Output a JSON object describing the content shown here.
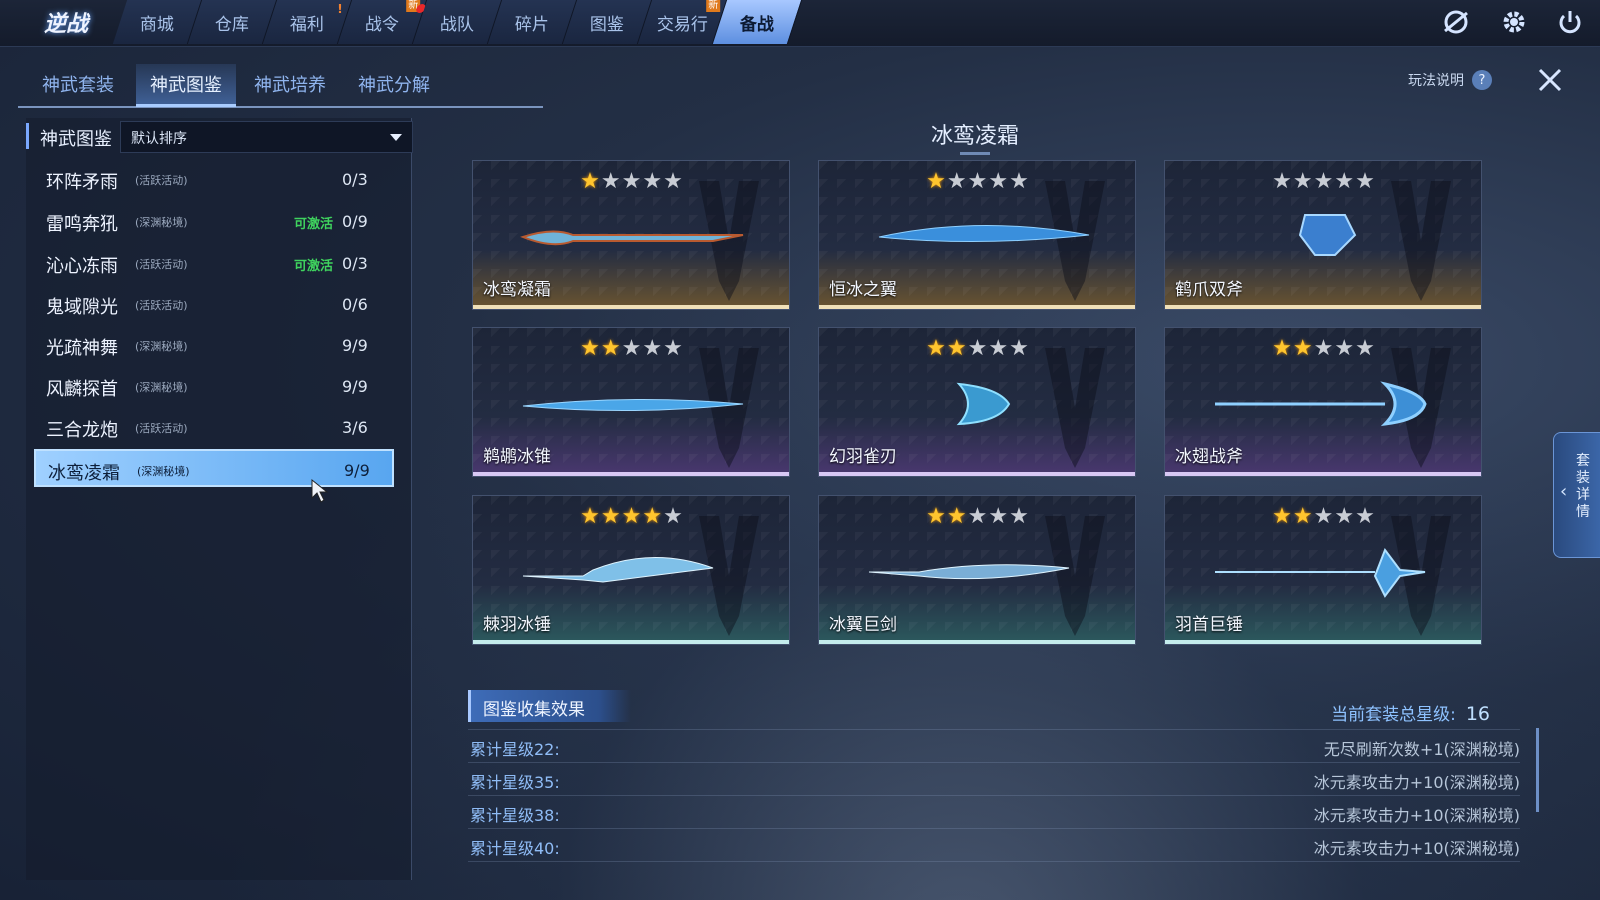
{
  "app": {
    "logo_text": "逆战"
  },
  "nav": {
    "tabs": [
      {
        "label": "商城"
      },
      {
        "label": "仓库"
      },
      {
        "label": "福利"
      },
      {
        "label": "战令"
      },
      {
        "label": "战队"
      },
      {
        "label": "碎片"
      },
      {
        "label": "图鉴"
      },
      {
        "label": "交易行"
      },
      {
        "label": "备战"
      }
    ],
    "new_badge": "新",
    "alert_mark": "!"
  },
  "subtabs": [
    "神武套装",
    "神武图鉴",
    "神武培养",
    "神武分解"
  ],
  "help_label": "玩法说明",
  "help_icon_text": "?",
  "left": {
    "title": "神武图鉴",
    "sort_value": "默认排序",
    "rows": [
      {
        "name": "环阵矛雨",
        "source": "(活跃活动)",
        "activatable": "",
        "progress": "0/3"
      },
      {
        "name": "雷鸣奔犼",
        "source": "(深渊秘境)",
        "activatable": "可激活",
        "progress": "0/9"
      },
      {
        "name": "沁心冻雨",
        "source": "(活跃活动)",
        "activatable": "可激活",
        "progress": "0/3"
      },
      {
        "name": "鬼域隙光",
        "source": "(活跃活动)",
        "activatable": "",
        "progress": "0/6"
      },
      {
        "name": "光疏神舞",
        "source": "(深渊秘境)",
        "activatable": "",
        "progress": "9/9"
      },
      {
        "name": "风麟探首",
        "source": "(深渊秘境)",
        "activatable": "",
        "progress": "9/9"
      },
      {
        "name": "三合龙炮",
        "source": "(活跃活动)",
        "activatable": "",
        "progress": "3/6"
      },
      {
        "name": "冰鸾凌霜",
        "source": "(深渊秘境)",
        "activatable": "",
        "progress": "9/9"
      }
    ]
  },
  "set_title": "冰鸾凌霜",
  "cards": [
    {
      "name": "冰鸾凝霜",
      "stars": "1",
      "rarity": "gold"
    },
    {
      "name": "恒冰之翼",
      "stars": "1",
      "rarity": "gold"
    },
    {
      "name": "鹤爪双斧",
      "stars": "0",
      "rarity": "gold"
    },
    {
      "name": "鹈鹕冰锥",
      "stars": "2",
      "rarity": "purple"
    },
    {
      "name": "幻羽雀刃",
      "stars": "2",
      "rarity": "purple"
    },
    {
      "name": "冰翅战斧",
      "stars": "2",
      "rarity": "purple"
    },
    {
      "name": "棘羽冰锤",
      "stars": "4",
      "rarity": "teal"
    },
    {
      "name": "冰翼巨剑",
      "stars": "2",
      "rarity": "teal"
    },
    {
      "name": "羽首巨锤",
      "stars": "2",
      "rarity": "teal"
    }
  ],
  "rarity_colors": {
    "gold": {
      "glow": "#6b5530",
      "line": "#f0e0b8"
    },
    "purple": {
      "glow": "#4a3870",
      "line": "#d8c8f4"
    },
    "teal": {
      "glow": "#2c5a5e",
      "line": "#c4ecec"
    }
  },
  "collection": {
    "title": "图鉴收集效果",
    "total_label": "当前套装总星级:",
    "total_value": "16",
    "rows": [
      {
        "k": "累计星级22:",
        "v": "无尽刷新次数+1(深渊秘境)"
      },
      {
        "k": "累计星级35:",
        "v": "冰元素攻击力+10(深渊秘境)"
      },
      {
        "k": "累计星级38:",
        "v": "冰元素攻击力+10(深渊秘境)"
      },
      {
        "k": "累计星级40:",
        "v": "冰元素攻击力+10(深渊秘境)"
      }
    ]
  },
  "side_tab": "套装详情"
}
